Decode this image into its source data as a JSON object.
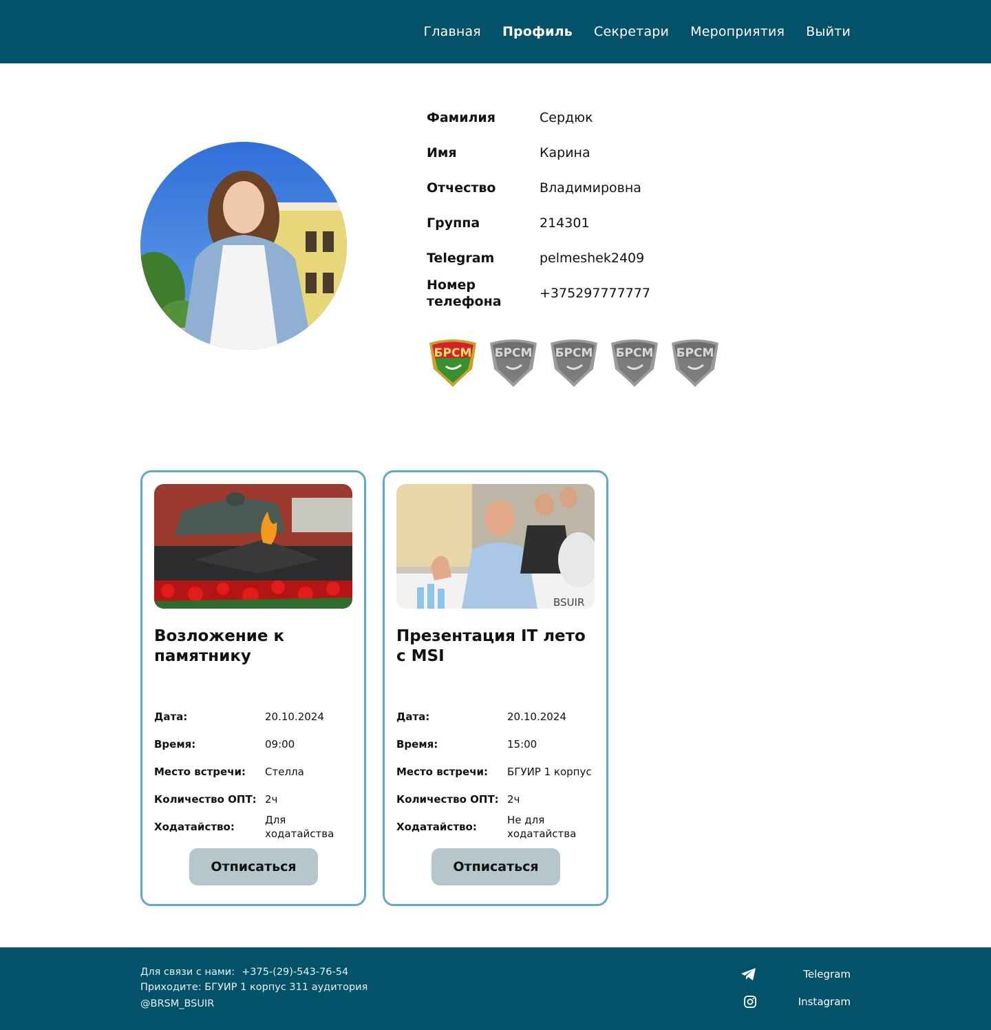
{
  "nav": {
    "items": [
      {
        "label": "Главная"
      },
      {
        "label": "Профиль"
      },
      {
        "label": "Секретари"
      },
      {
        "label": "Мероприятия"
      },
      {
        "label": "Выйти"
      }
    ],
    "active": "Профиль"
  },
  "profile": {
    "fields": [
      {
        "label": "Фамилия",
        "value": "Сердюк"
      },
      {
        "label": "Имя",
        "value": "Карина"
      },
      {
        "label": "Отчество",
        "value": "Владимировна"
      },
      {
        "label": "Группа",
        "value": "214301"
      },
      {
        "label": "Telegram",
        "value": "pelmeshek2409"
      },
      {
        "label": "Номер телефона",
        "value": "+375297777777"
      }
    ],
    "badges": {
      "earned": 1,
      "total": 5,
      "text": "БРСМ"
    }
  },
  "events": [
    {
      "title": "Возложение к памятнику",
      "details": [
        {
          "label": "Дата:",
          "value": "20.10.2024"
        },
        {
          "label": "Время:",
          "value": "09:00"
        },
        {
          "label": "Место встречи:",
          "value": "Стелла"
        },
        {
          "label": "Количество ОПТ:",
          "value": "2ч"
        },
        {
          "label": "Ходатайство:",
          "value": "Для ходатайства"
        }
      ],
      "button": "Отписаться"
    },
    {
      "title": "Презентация IT лето с MSI",
      "details": [
        {
          "label": "Дата:",
          "value": "20.10.2024"
        },
        {
          "label": "Время:",
          "value": "15:00"
        },
        {
          "label": "Место встречи:",
          "value": "БГУИР 1 корпус"
        },
        {
          "label": "Количество ОПТ:",
          "value": "2ч"
        },
        {
          "label": "Ходатайство:",
          "value": "Не для ходатайства"
        }
      ],
      "button": "Отписаться",
      "image_watermark": "BSUIR"
    }
  ],
  "footer": {
    "contact_label": "Для связи с нами:",
    "phone": "+375-(29)-543-76-54",
    "address": "Приходите: БГУИР 1 корпус 311 аудитория",
    "handle": "@BRSM_BSUIR",
    "links": [
      {
        "label": "Telegram",
        "icon": "telegram-icon"
      },
      {
        "label": "Instagram",
        "icon": "instagram-icon"
      }
    ]
  },
  "colors": {
    "header_bg": "#04526a",
    "card_border": "#5fa8ce",
    "button_bg": "#b5c6cd"
  }
}
